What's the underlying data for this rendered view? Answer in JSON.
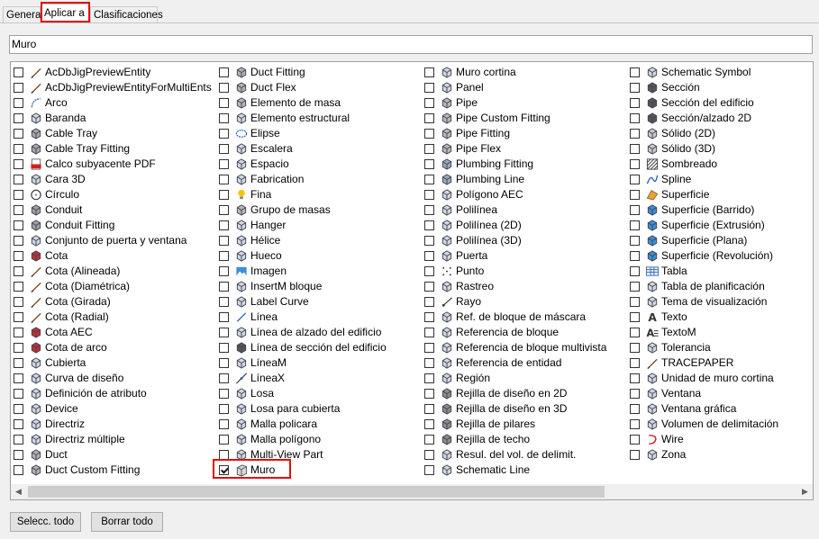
{
  "tabs": [
    {
      "label": "General"
    },
    {
      "label": "Aplicar a"
    },
    {
      "label": "Clasificaciones"
    }
  ],
  "search": {
    "value": "Muro"
  },
  "columns": [
    [
      {
        "label": "AcDbJigPreviewEntity",
        "icon": "brush-icon"
      },
      {
        "label": "AcDbJigPreviewEntityForMultiEnts",
        "icon": "brush-icon"
      },
      {
        "label": "Arco",
        "icon": "arc-icon"
      },
      {
        "label": "Baranda",
        "icon": "railing-icon"
      },
      {
        "label": "Cable Tray",
        "icon": "cable-tray-icon"
      },
      {
        "label": "Cable Tray Fitting",
        "icon": "cable-tray-fitting-icon"
      },
      {
        "label": "Calco subyacente PDF",
        "icon": "pdf-icon"
      },
      {
        "label": "Cara 3D",
        "icon": "face-3d-icon"
      },
      {
        "label": "Círculo",
        "icon": "circle-icon"
      },
      {
        "label": "Conduit",
        "icon": "conduit-icon"
      },
      {
        "label": "Conduit Fitting",
        "icon": "conduit-fitting-icon"
      },
      {
        "label": "Conjunto de puerta y ventana",
        "icon": "door-window-assembly-icon"
      },
      {
        "label": "Cota",
        "icon": "dimension-icon"
      },
      {
        "label": "Cota (Alineada)",
        "icon": "brush-icon"
      },
      {
        "label": "Cota (Diamétrica)",
        "icon": "brush-icon"
      },
      {
        "label": "Cota (Girada)",
        "icon": "brush-icon"
      },
      {
        "label": "Cota (Radial)",
        "icon": "brush-icon"
      },
      {
        "label": "Cota AEC",
        "icon": "aec-dimension-icon"
      },
      {
        "label": "Cota de arco",
        "icon": "arc-dimension-icon"
      },
      {
        "label": "Cubierta",
        "icon": "roof-icon"
      },
      {
        "label": "Curva de diseño",
        "icon": "layout-curve-icon"
      },
      {
        "label": "Definición de atributo",
        "icon": "attribute-tag-icon"
      },
      {
        "label": "Device",
        "icon": "device-icon"
      },
      {
        "label": "Directriz",
        "icon": "leader-icon"
      },
      {
        "label": "Directriz múltiple",
        "icon": "multileader-icon"
      },
      {
        "label": "Duct",
        "icon": "duct-icon"
      },
      {
        "label": "Duct Custom Fitting",
        "icon": "duct-custom-fitting-icon"
      }
    ],
    [
      {
        "label": "Duct Fitting",
        "icon": "duct-fitting-icon"
      },
      {
        "label": "Duct Flex",
        "icon": "duct-flex-icon"
      },
      {
        "label": "Elemento de masa",
        "icon": "mass-element-icon"
      },
      {
        "label": "Elemento estructural",
        "icon": "structural-member-icon"
      },
      {
        "label": "Elipse",
        "icon": "ellipse-icon"
      },
      {
        "label": "Escalera",
        "icon": "stair-icon"
      },
      {
        "label": "Espacio",
        "icon": "space-icon"
      },
      {
        "label": "Fabrication",
        "icon": "fabrication-icon"
      },
      {
        "label": "Fina",
        "icon": "light-bulb-icon"
      },
      {
        "label": "Grupo de masas",
        "icon": "mass-group-icon"
      },
      {
        "label": "Hanger",
        "icon": "hanger-icon"
      },
      {
        "label": "Hélice",
        "icon": "helix-icon"
      },
      {
        "label": "Hueco",
        "icon": "opening-icon"
      },
      {
        "label": "Imagen",
        "icon": "image-icon"
      },
      {
        "label": "InsertM bloque",
        "icon": "minsert-block-icon"
      },
      {
        "label": "Label Curve",
        "icon": "label-curve-icon"
      },
      {
        "label": "Línea",
        "icon": "line-icon"
      },
      {
        "label": "Línea de alzado del edificio",
        "icon": "elevation-line-icon"
      },
      {
        "label": "Línea de sección del edificio",
        "icon": "section-line-icon"
      },
      {
        "label": "LíneaM",
        "icon": "mline-icon"
      },
      {
        "label": "LíneaX",
        "icon": "xline-icon"
      },
      {
        "label": "Losa",
        "icon": "slab-icon"
      },
      {
        "label": "Losa para cubierta",
        "icon": "roof-slab-icon"
      },
      {
        "label": "Malla policara",
        "icon": "polyface-mesh-icon"
      },
      {
        "label": "Malla polígono",
        "icon": "polygon-mesh-icon"
      },
      {
        "label": "Multi-View Part",
        "icon": "multi-view-part-icon"
      },
      {
        "label": "Muro",
        "icon": "wall-icon",
        "checked": true
      }
    ],
    [
      {
        "label": "Muro cortina",
        "icon": "curtain-wall-icon"
      },
      {
        "label": "Panel",
        "icon": "panel-icon"
      },
      {
        "label": "Pipe",
        "icon": "pipe-icon"
      },
      {
        "label": "Pipe Custom Fitting",
        "icon": "pipe-custom-fitting-icon"
      },
      {
        "label": "Pipe Fitting",
        "icon": "pipe-fitting-icon"
      },
      {
        "label": "Pipe Flex",
        "icon": "pipe-flex-icon"
      },
      {
        "label": "Plumbing Fitting",
        "icon": "plumbing-fitting-icon"
      },
      {
        "label": "Plumbing Line",
        "icon": "plumbing-line-icon"
      },
      {
        "label": "Polígono AEC",
        "icon": "aec-polygon-icon"
      },
      {
        "label": "Polilínea",
        "icon": "polyline-icon"
      },
      {
        "label": "Polilínea (2D)",
        "icon": "polyline-2d-icon"
      },
      {
        "label": "Polilínea (3D)",
        "icon": "polyline-3d-icon"
      },
      {
        "label": "Puerta",
        "icon": "door-icon"
      },
      {
        "label": "Punto",
        "icon": "point-icon"
      },
      {
        "label": "Rastreo",
        "icon": "trace-icon"
      },
      {
        "label": "Rayo",
        "icon": "ray-icon"
      },
      {
        "label": "Ref. de bloque de máscara",
        "icon": "mask-block-ref-icon"
      },
      {
        "label": "Referencia de bloque",
        "icon": "block-reference-icon"
      },
      {
        "label": "Referencia de bloque multivista",
        "icon": "multiview-block-ref-icon"
      },
      {
        "label": "Referencia de entidad",
        "icon": "entity-reference-icon"
      },
      {
        "label": "Región",
        "icon": "region-icon"
      },
      {
        "label": "Rejilla de diseño en 2D",
        "icon": "layout-grid-2d-icon"
      },
      {
        "label": "Rejilla de diseño en 3D",
        "icon": "layout-grid-3d-icon"
      },
      {
        "label": "Rejilla de pilares",
        "icon": "column-grid-icon"
      },
      {
        "label": "Rejilla de techo",
        "icon": "ceiling-grid-icon"
      },
      {
        "label": "Resul. del vol. de delimit.",
        "icon": "bounding-volume-result-icon"
      },
      {
        "label": "Schematic Line",
        "icon": "schematic-line-icon"
      }
    ],
    [
      {
        "label": "Schematic Symbol",
        "icon": "schematic-symbol-icon"
      },
      {
        "label": "Sección",
        "icon": "section-icon"
      },
      {
        "label": "Sección del edificio",
        "icon": "building-section-icon"
      },
      {
        "label": "Sección/alzado 2D",
        "icon": "section-elevation-2d-icon"
      },
      {
        "label": "Sólido (2D)",
        "icon": "solid-2d-icon"
      },
      {
        "label": "Sólido (3D)",
        "icon": "solid-3d-icon"
      },
      {
        "label": "Sombreado",
        "icon": "hatch-icon"
      },
      {
        "label": "Spline",
        "icon": "spline-icon"
      },
      {
        "label": "Superficie",
        "icon": "surface-icon"
      },
      {
        "label": "Superficie (Barrido)",
        "icon": "sweep-surface-icon"
      },
      {
        "label": "Superficie (Extrusión)",
        "icon": "extrude-surface-icon"
      },
      {
        "label": "Superficie (Plana)",
        "icon": "planar-surface-icon"
      },
      {
        "label": "Superficie (Revolución)",
        "icon": "revolve-surface-icon"
      },
      {
        "label": "Tabla",
        "icon": "table-icon"
      },
      {
        "label": "Tabla de planificación",
        "icon": "schedule-table-icon"
      },
      {
        "label": "Tema de visualización",
        "icon": "display-theme-icon"
      },
      {
        "label": "Texto",
        "icon": "text-icon"
      },
      {
        "label": "TextoM",
        "icon": "mtext-icon"
      },
      {
        "label": "Tolerancia",
        "icon": "tolerance-icon"
      },
      {
        "label": "TRACEPAPER",
        "icon": "brush-icon"
      },
      {
        "label": "Unidad de muro cortina",
        "icon": "curtain-wall-unit-icon"
      },
      {
        "label": "Ventana",
        "icon": "window-icon"
      },
      {
        "label": "Ventana gráfica",
        "icon": "viewport-icon"
      },
      {
        "label": "Volumen de delimitación",
        "icon": "bounding-volume-icon"
      },
      {
        "label": "Wire",
        "icon": "wire-icon"
      },
      {
        "label": "Zona",
        "icon": "zone-icon"
      }
    ]
  ],
  "buttons": {
    "select_all": "Selecc. todo",
    "clear_all": "Borrar todo"
  },
  "colors": {
    "highlight": "#e01010",
    "checkmark": "#1a1a1a",
    "selection_border": "#a0a0a0"
  }
}
